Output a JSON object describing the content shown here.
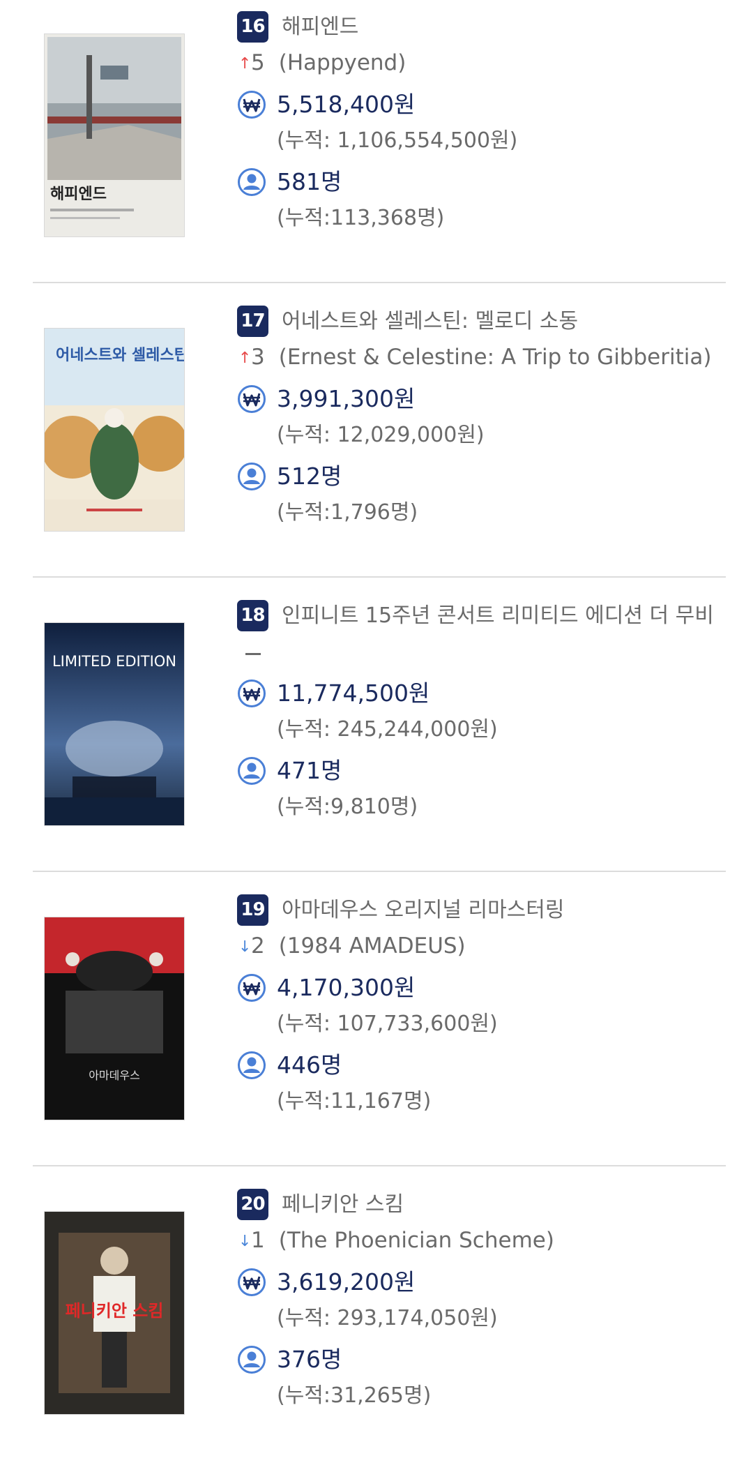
{
  "entries": [
    {
      "rank": "16",
      "title": "해피엔드",
      "change": {
        "direction": "up",
        "amount": "5"
      },
      "original_title": "(Happyend)",
      "sales": "5,518,400원",
      "sales_cumulative": "(누적: 1,106,554,500원)",
      "audience": "581명",
      "audience_cumulative": "(누적:113,368명)",
      "poster_text": "해피엔드"
    },
    {
      "rank": "17",
      "title": "어네스트와 셀레스틴: 멜로디 소동",
      "change": {
        "direction": "up",
        "amount": "3"
      },
      "original_title": "(Ernest & Celestine: A Trip to Gibberitia)",
      "sales": "3,991,300원",
      "sales_cumulative": "(누적: 12,029,000원)",
      "audience": "512명",
      "audience_cumulative": "(누적:1,796명)",
      "poster_text": "어네스트와 셀레스틴"
    },
    {
      "rank": "18",
      "title": "인피니트 15주년 콘서트 리미티드 에디션 더 무비",
      "change": {
        "direction": "none",
        "amount": ""
      },
      "original_title": "",
      "sales": "11,774,500원",
      "sales_cumulative": "(누적: 245,244,000원)",
      "audience": "471명",
      "audience_cumulative": "(누적:9,810명)",
      "poster_text": "LIMITED EDITION"
    },
    {
      "rank": "19",
      "title": "아마데우스 오리지널 리마스터링",
      "change": {
        "direction": "down",
        "amount": "2"
      },
      "original_title": "(1984 AMADEUS)",
      "sales": "4,170,300원",
      "sales_cumulative": "(누적: 107,733,600원)",
      "audience": "446명",
      "audience_cumulative": "(누적:11,167명)",
      "poster_text": "아마데우스"
    },
    {
      "rank": "20",
      "title": "페니키안 스킴",
      "change": {
        "direction": "down",
        "amount": "1"
      },
      "original_title": "(The Phoenician Scheme)",
      "sales": "3,619,200원",
      "sales_cumulative": "(누적: 293,174,050원)",
      "audience": "376명",
      "audience_cumulative": "(누적:31,265명)",
      "poster_text": "페니키안 스킴"
    }
  ],
  "icons": {
    "sales": "won-icon",
    "audience": "person-icon"
  },
  "colors": {
    "navy": "#1a2a5e",
    "up": "#e74a4a",
    "down": "#4a86d9",
    "icon": "#4a7fd6"
  }
}
